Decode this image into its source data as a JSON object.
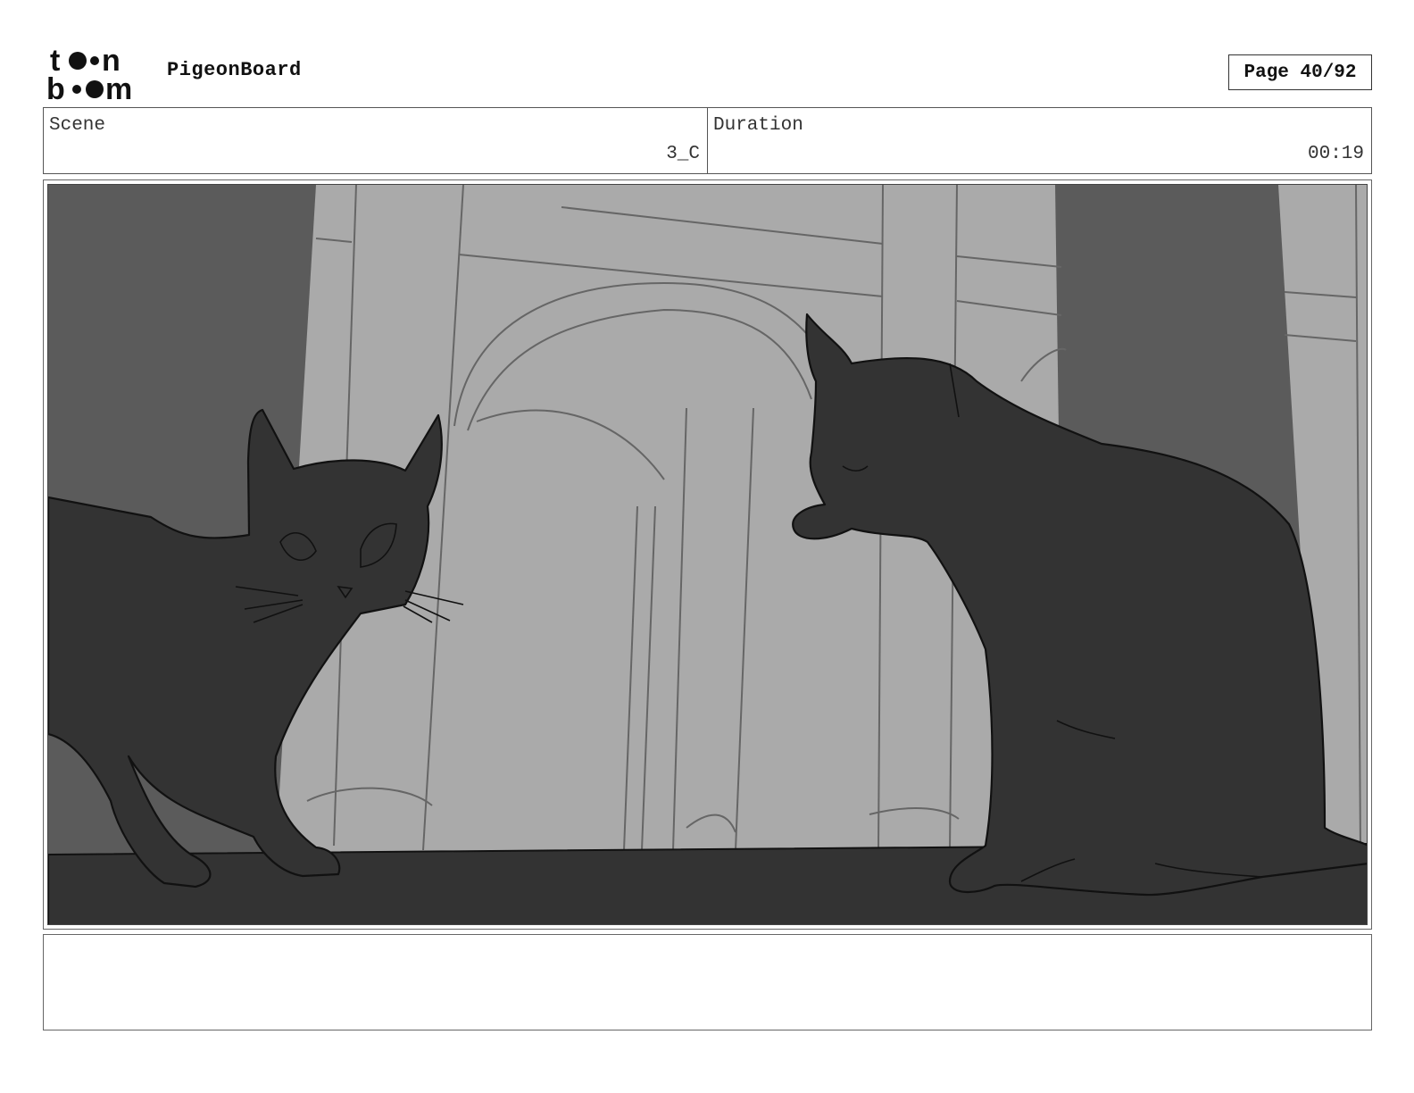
{
  "header": {
    "brand": "toon boom",
    "project_name": "PigeonBoard",
    "page_label": "Page 40/92"
  },
  "scene": {
    "label": "Scene",
    "value": "3_C"
  },
  "duration": {
    "label": "Duration",
    "value": "00:19"
  },
  "panel": {
    "icon": "storyboard-sketch-two-cats"
  },
  "notes": {
    "text": ""
  }
}
